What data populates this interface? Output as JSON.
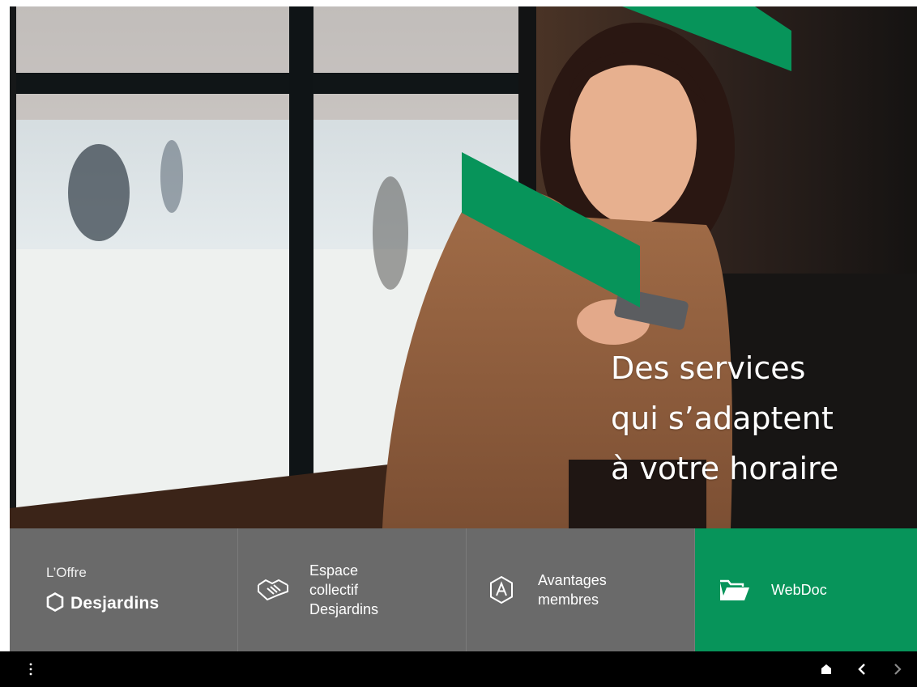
{
  "hero": {
    "headline_lines": [
      "Des services",
      "qui s’adaptent",
      "à votre horaire"
    ]
  },
  "tiles": [
    {
      "label_top": "L’Offre",
      "brand": "Desjardins",
      "icon": "hexagon-logo-icon"
    },
    {
      "lines": [
        "Espace",
        "collectif",
        "Desjardins"
      ],
      "icon": "handshake-icon"
    },
    {
      "lines": [
        "Avantages",
        "membres"
      ],
      "icon": "avantages-a-badge-icon"
    },
    {
      "lines": [
        "WebDoc"
      ],
      "icon": "folder-icon"
    }
  ],
  "bottombar": {
    "left_icon": "more-vertical-icon",
    "right_icons": [
      "home-icon",
      "back-icon",
      "forward-icon"
    ]
  },
  "colors": {
    "accent_green": "#07945a",
    "tile_gray": "#6a6a6a",
    "bar_black": "#000000"
  }
}
